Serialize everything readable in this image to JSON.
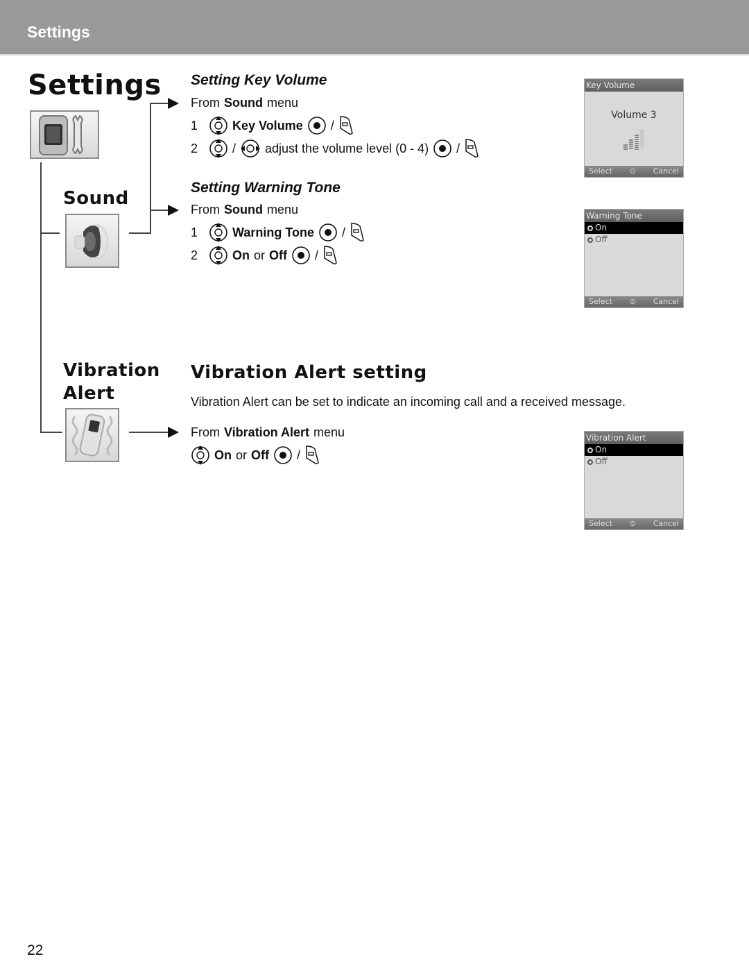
{
  "header": {
    "title": "Settings"
  },
  "left": {
    "main_title": "Settings",
    "sound_label": "Sound",
    "vibration_label_line1": "Vibration",
    "vibration_label_line2": "Alert"
  },
  "key_volume": {
    "heading": "Setting Key Volume",
    "from_prefix": "From",
    "from_menu": "Sound",
    "from_suffix": "menu",
    "step1_num": "1",
    "step1_text": "Key Volume",
    "step2_num": "2",
    "step2_text": "adjust the volume level (0 - 4)",
    "separator": "/",
    "screen": {
      "title": "Key Volume",
      "body": "Volume 3",
      "volume_level": 3,
      "volume_max": 4,
      "left_soft": "Select",
      "right_soft": "Cancel"
    }
  },
  "warning_tone": {
    "heading": "Setting Warning Tone",
    "from_prefix": "From",
    "from_menu": "Sound",
    "from_suffix": "menu",
    "step1_num": "1",
    "step1_text": "Warning Tone",
    "step2_num": "2",
    "step2_on": "On",
    "step2_or": "or",
    "step2_off": "Off",
    "separator": "/",
    "screen": {
      "title": "Warning Tone",
      "options": [
        "On",
        "Off"
      ],
      "selected": "On",
      "left_soft": "Select",
      "right_soft": "Cancel"
    }
  },
  "vibration_alert": {
    "heading": "Vibration Alert setting",
    "description": "Vibration Alert can be set to indicate an incoming call and a received message.",
    "from_prefix": "From",
    "from_menu": "Vibration Alert",
    "from_suffix": "menu",
    "step_on": "On",
    "step_or": "or",
    "step_off": "Off",
    "separator": "/",
    "screen": {
      "title": "Vibration Alert",
      "options": [
        "On",
        "Off"
      ],
      "selected": "On",
      "left_soft": "Select",
      "right_soft": "Cancel"
    }
  },
  "icons": {
    "nav_up_down": "nav-up-down-icon",
    "nav_left_right": "nav-left-right-icon",
    "ok_key": "ok-key-icon",
    "soft_key": "soft-key-icon"
  },
  "page_number": "22"
}
